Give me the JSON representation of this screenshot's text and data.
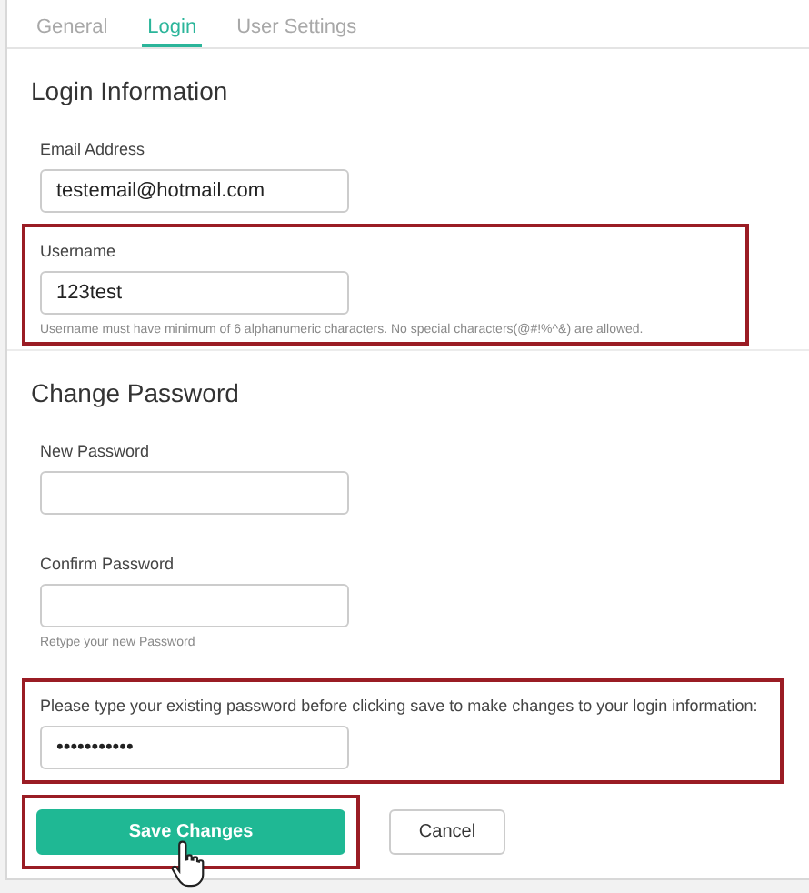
{
  "tabs": [
    {
      "label": "General",
      "selected": false
    },
    {
      "label": "Login",
      "selected": true
    },
    {
      "label": "User Settings",
      "selected": false
    }
  ],
  "sections": [
    {
      "title": "Login Information",
      "fields": [
        {
          "label": "Email Address",
          "value": "testemail@hotmail.com",
          "highlighted": false
        },
        {
          "label": "Username",
          "value": "123test",
          "hint": "Username must have minimum of 6 alphanumeric characters. No special characters(@#!%^&) are allowed.",
          "highlighted": true
        }
      ]
    },
    {
      "title": "Change Password",
      "fields": [
        {
          "label": "New Password",
          "highlighted": false
        },
        {
          "label": "Confirm Password",
          "hint": "Retype your new Password",
          "highlighted": false
        },
        {
          "label": "Please type your existing password before clicking save to make changes to your login information:",
          "value": "•••••••••••",
          "highlighted": true
        }
      ]
    }
  ],
  "buttons": [
    {
      "label": "Save Changes",
      "kind": "primary",
      "highlighted": true,
      "hovered": true
    },
    {
      "label": "Cancel",
      "kind": "secondary",
      "highlighted": false,
      "hovered": false
    }
  ]
}
